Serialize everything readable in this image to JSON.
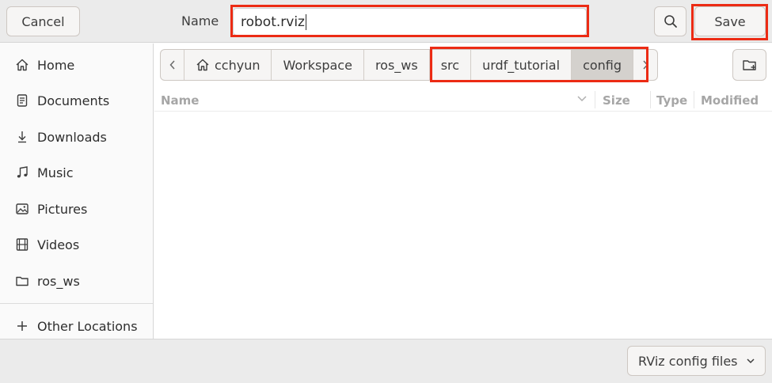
{
  "header": {
    "cancel_label": "Cancel",
    "name_label": "Name",
    "filename_value": "robot.rviz",
    "search_icon": "search-icon",
    "save_label": "Save"
  },
  "sidebar": {
    "items": [
      {
        "label": "Home",
        "icon": "home-icon"
      },
      {
        "label": "Documents",
        "icon": "document-icon"
      },
      {
        "label": "Downloads",
        "icon": "download-icon"
      },
      {
        "label": "Music",
        "icon": "music-icon"
      },
      {
        "label": "Pictures",
        "icon": "pictures-icon"
      },
      {
        "label": "Videos",
        "icon": "videos-icon"
      },
      {
        "label": "ros_ws",
        "icon": "folder-icon"
      }
    ],
    "other_locations": {
      "label": "Other Locations",
      "icon": "plus-icon"
    }
  },
  "pathbar": {
    "crumbs": [
      "cchyun",
      "Workspace",
      "ros_ws",
      "src",
      "urdf_tutorial",
      "config"
    ],
    "active_crumb": "config"
  },
  "columns": {
    "name": "Name",
    "size": "Size",
    "type": "Type",
    "modified": "Modified"
  },
  "footer": {
    "filter_value": "RViz config files"
  },
  "colors": {
    "highlight": "#ec2b14",
    "active_crumb_bg": "#d4d1cd",
    "header_bg": "#ebebeb"
  }
}
